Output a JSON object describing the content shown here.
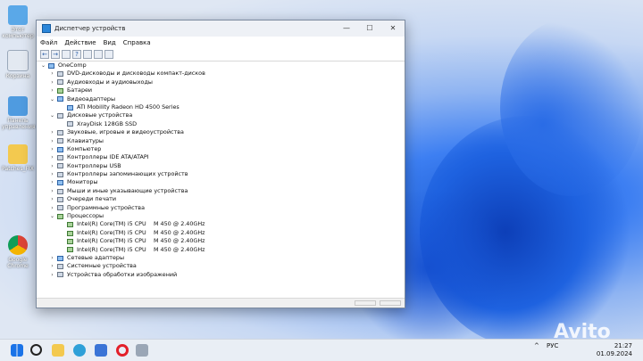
{
  "desktop": {
    "icons": [
      {
        "label": "Этот компьютер"
      },
      {
        "label": "Корзина"
      },
      {
        "label": "Панель управления"
      },
      {
        "label": "Patches_FIX"
      },
      {
        "label": "Google Chrome"
      }
    ]
  },
  "window": {
    "title": "Диспетчер устройств",
    "menu": [
      "Файл",
      "Действие",
      "Вид",
      "Справка"
    ],
    "controls": {
      "minimize": "—",
      "maximize": "☐",
      "close": "✕"
    }
  },
  "tree": {
    "root": "OneComp",
    "items": [
      {
        "label": "DVD-дисководы и дисководы компакт-дисков"
      },
      {
        "label": "Аудиовходы и аудиовыходы"
      },
      {
        "label": "Батареи"
      },
      {
        "label": "Видеоадаптеры",
        "children": [
          "ATI Mobility Radeon HD 4500 Series"
        ]
      },
      {
        "label": "Дисковые устройства",
        "children": [
          "XrayDisk 128GB SSD"
        ]
      },
      {
        "label": "Звуковые, игровые и видеоустройства"
      },
      {
        "label": "Клавиатуры"
      },
      {
        "label": "Компьютер"
      },
      {
        "label": "Контроллеры IDE ATA/ATAPI"
      },
      {
        "label": "Контроллеры USB"
      },
      {
        "label": "Контроллеры запоминающих устройств"
      },
      {
        "label": "Мониторы"
      },
      {
        "label": "Мыши и иные указывающие устройства"
      },
      {
        "label": "Очереди печати"
      },
      {
        "label": "Программные устройства"
      },
      {
        "label": "Процессоры"
      },
      {
        "label": "Сетевые адаптеры"
      },
      {
        "label": "Системные устройства"
      },
      {
        "label": "Устройства обработки изображений"
      }
    ],
    "processors": [
      {
        "name": "Intel(R) Core(TM) i5 CPU",
        "model": "M 450 @ 2.40GHz"
      },
      {
        "name": "Intel(R) Core(TM) i5 CPU",
        "model": "M 450 @ 2.40GHz"
      },
      {
        "name": "Intel(R) Core(TM) i5 CPU",
        "model": "M 450 @ 2.40GHz"
      },
      {
        "name": "Intel(R) Core(TM) i5 CPU",
        "model": "M 450 @ 2.40GHz"
      }
    ]
  },
  "taskbar": {
    "lang": "РУС",
    "time": "21:27",
    "date": "01.09.2024"
  },
  "watermark": "Avito"
}
